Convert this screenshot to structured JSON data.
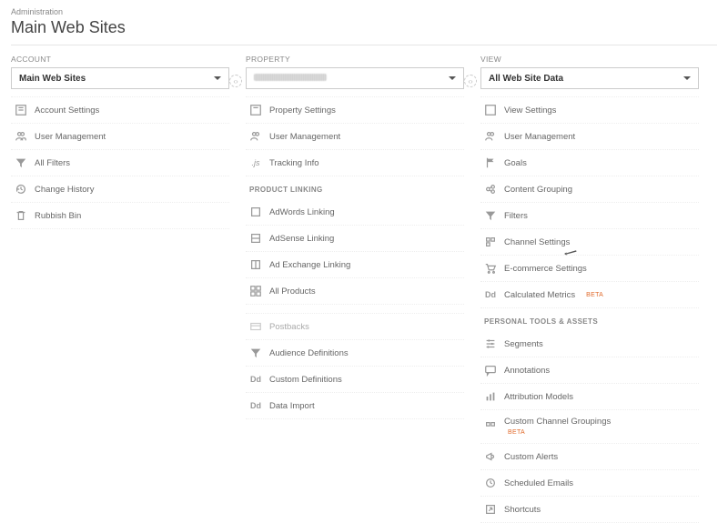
{
  "breadcrumb": "Administration",
  "page_title": "Main Web Sites",
  "columns": {
    "account": {
      "head": "ACCOUNT",
      "selector_value": "Main Web Sites",
      "items": [
        {
          "label": "Account Settings"
        },
        {
          "label": "User Management"
        },
        {
          "label": "All Filters"
        },
        {
          "label": "Change History"
        },
        {
          "label": "Rubbish Bin"
        }
      ]
    },
    "property": {
      "head": "PROPERTY",
      "selector_value": "",
      "items_top": [
        {
          "label": "Property Settings"
        },
        {
          "label": "User Management"
        },
        {
          "label": "Tracking Info"
        }
      ],
      "section_product_linking": "PRODUCT LINKING",
      "items_product": [
        {
          "label": "AdWords Linking"
        },
        {
          "label": "AdSense Linking"
        },
        {
          "label": "Ad Exchange Linking"
        },
        {
          "label": "All Products"
        }
      ],
      "items_bottom": [
        {
          "label": "Postbacks"
        },
        {
          "label": "Audience Definitions"
        },
        {
          "label": "Custom Definitions"
        },
        {
          "label": "Data Import"
        }
      ]
    },
    "view": {
      "head": "VIEW",
      "selector_value": "All Web Site Data",
      "items_top": [
        {
          "label": "View Settings"
        },
        {
          "label": "User Management"
        },
        {
          "label": "Goals"
        },
        {
          "label": "Content Grouping"
        },
        {
          "label": "Filters"
        },
        {
          "label": "Channel Settings"
        },
        {
          "label": "E-commerce Settings"
        },
        {
          "label": "Calculated Metrics",
          "badge": "BETA"
        }
      ],
      "section_personal": "PERSONAL TOOLS & ASSETS",
      "items_personal": [
        {
          "label": "Segments"
        },
        {
          "label": "Annotations"
        },
        {
          "label": "Attribution Models"
        },
        {
          "label": "Custom Channel Groupings",
          "badge": "BETA"
        },
        {
          "label": "Custom Alerts"
        },
        {
          "label": "Scheduled Emails"
        },
        {
          "label": "Shortcuts"
        }
      ]
    }
  }
}
